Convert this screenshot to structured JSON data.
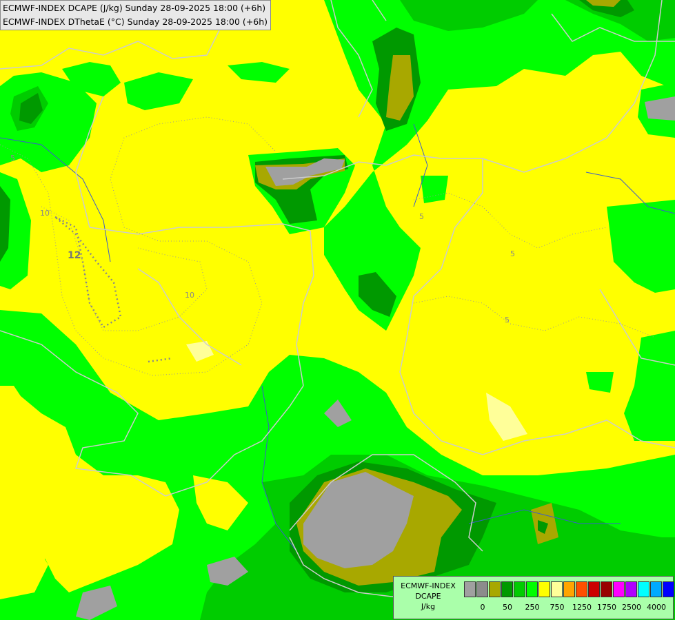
{
  "header": {
    "line1": "ECMWF-INDEX DCAPE (J/kg) Sunday 28-09-2025 18:00 (+6h)",
    "line2": "ECMWF-INDEX DThetaE (°C) Sunday 28-09-2025 18:00 (+6h)"
  },
  "legend": {
    "label_source": "ECMWF-INDEX",
    "label_param": "DCAPE",
    "label_unit": "J/kg",
    "colors": [
      "#a0a0a0",
      "#8c8c8c",
      "#a8a800",
      "#009900",
      "#00cc00",
      "#00ff00",
      "#ffff00",
      "#ffff99",
      "#ffa500",
      "#ff5000",
      "#cc0000",
      "#990000",
      "#ff00ff",
      "#b000ff",
      "#00ffff",
      "#00aaff",
      "#0000ff",
      "#000099"
    ],
    "ticks": [
      "0",
      "50",
      "250",
      "750",
      "1250",
      "1750",
      "2500",
      "4000"
    ]
  },
  "contour_labels": [
    "5",
    "10",
    "12",
    "10",
    "5",
    "5",
    "5"
  ],
  "colors": {
    "yellow": "#ffff00",
    "light_yellow": "#ffff99",
    "green": "#00ff00",
    "mid_green": "#00cc00",
    "dark_green": "#009900",
    "olive": "#a8a800",
    "grey": "#a0a0a0",
    "border": "#cccccc",
    "river": "#3a5ccc"
  }
}
